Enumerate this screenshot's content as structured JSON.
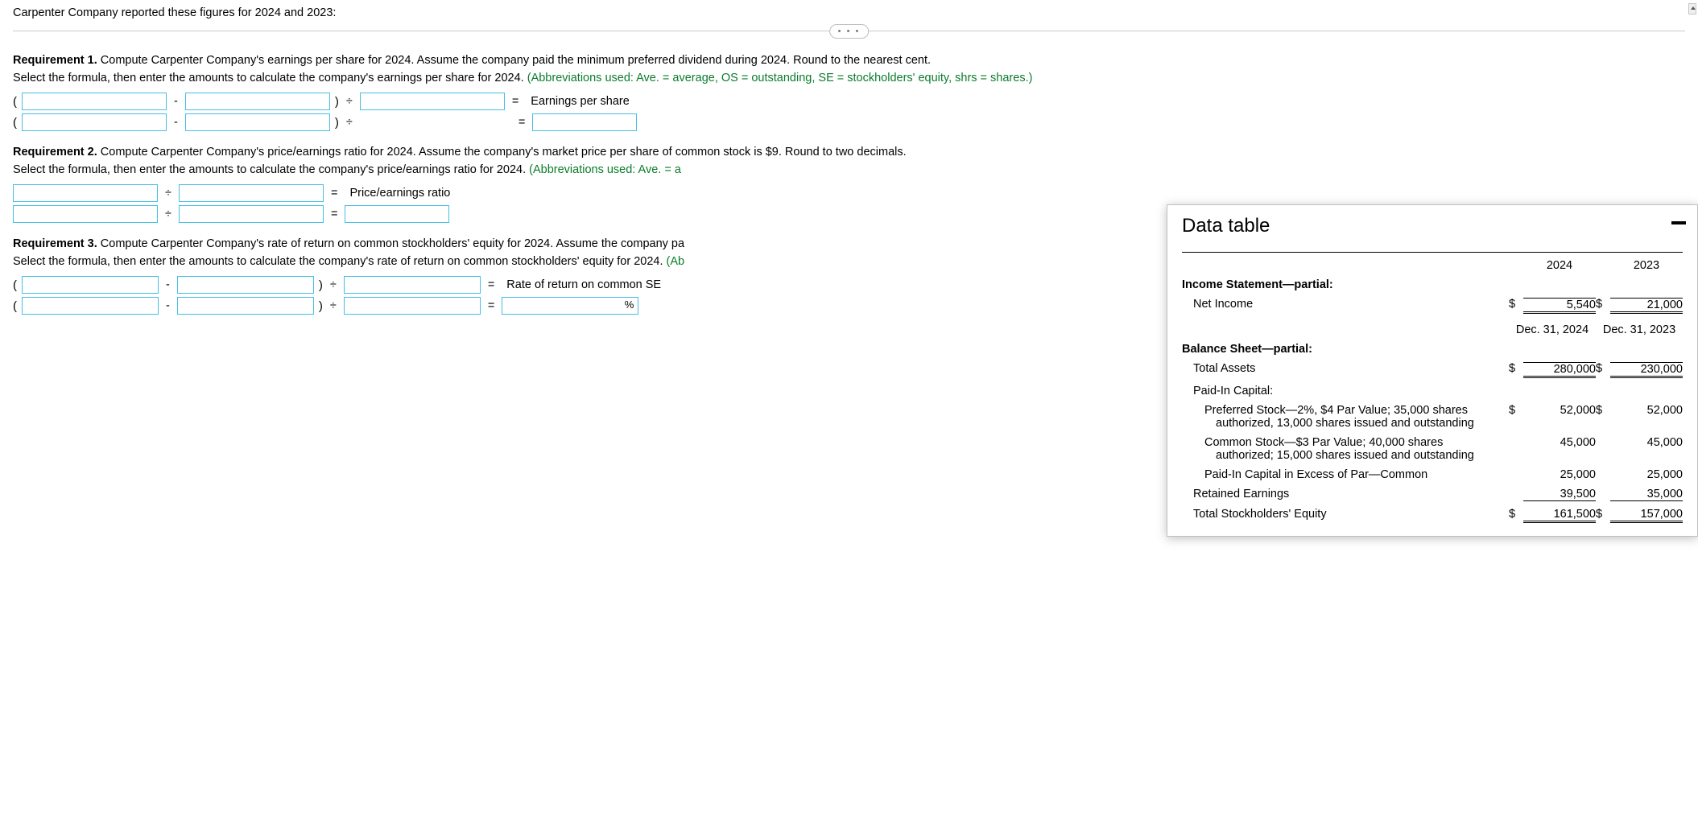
{
  "intro": "Carpenter Company reported these figures for 2024 and 2023:",
  "ellipsis": "• • •",
  "req1": {
    "title": "Requirement 1.",
    "text": " Compute Carpenter Company's earnings per share for 2024. Assume the company paid the minimum preferred dividend during 2024. Round to the nearest cent.",
    "select_prefix": "Select the formula, then enter the amounts to calculate the company's earnings per share for 2024. ",
    "abbr": "(Abbreviations used: Ave. = average, OS = outstanding, SE = stockholders' equity, shrs = shares.)",
    "result_label": "Earnings per share"
  },
  "req2": {
    "title": "Requirement 2.",
    "text": " Compute Carpenter Company's price/earnings ratio for 2024. Assume the company's market price per share of common stock is $9. Round to two decimals.",
    "select_prefix": "Select the formula, then enter the amounts to calculate the company's price/earnings ratio for 2024. ",
    "abbr": "(Abbreviations used: Ave. = a",
    "result_label": "Price/earnings ratio"
  },
  "req3": {
    "title": "Requirement 3.",
    "text": " Compute Carpenter Company's rate of return on common stockholders' equity for 2024. Assume the company pa",
    "select_prefix": "Select the formula, then enter the amounts to calculate the company's rate of return on common stockholders' equity for 2024. ",
    "abbr": "(Ab",
    "result_label": "Rate of return on common SE",
    "pct": "%"
  },
  "ops": {
    "minus": "-",
    "div": "÷",
    "eq": "=",
    "lp": "(",
    "rp": ")"
  },
  "data_table": {
    "title": "Data table",
    "col1": "2024",
    "col2": "2023",
    "income_header": "Income Statement—partial:",
    "net_income_label": "Net Income",
    "net_income_2024": "5,540",
    "net_income_2023": "21,000",
    "date1": "Dec. 31, 2024",
    "date2": "Dec. 31, 2023",
    "balance_header": "Balance Sheet—partial:",
    "total_assets_label": "Total Assets",
    "total_assets_2024": "280,000",
    "total_assets_2023": "230,000",
    "paid_in_label": "Paid-In Capital:",
    "pref_line1": "Preferred Stock—2%, $4 Par Value; 35,000 shares",
    "pref_line2": "authorized, 13,000 shares issued and outstanding",
    "pref_2024": "52,000",
    "pref_2023": "52,000",
    "common_line1": "Common Stock—$3 Par Value; 40,000 shares",
    "common_line2": "authorized; 15,000 shares issued and outstanding",
    "common_2024": "45,000",
    "common_2023": "45,000",
    "apic_label": "Paid-In Capital in Excess of Par—Common",
    "apic_2024": "25,000",
    "apic_2023": "25,000",
    "re_label": "Retained Earnings",
    "re_2024": "39,500",
    "re_2023": "35,000",
    "tse_label": "Total Stockholders' Equity",
    "tse_2024": "161,500",
    "tse_2023": "157,000",
    "dollar": "$"
  }
}
